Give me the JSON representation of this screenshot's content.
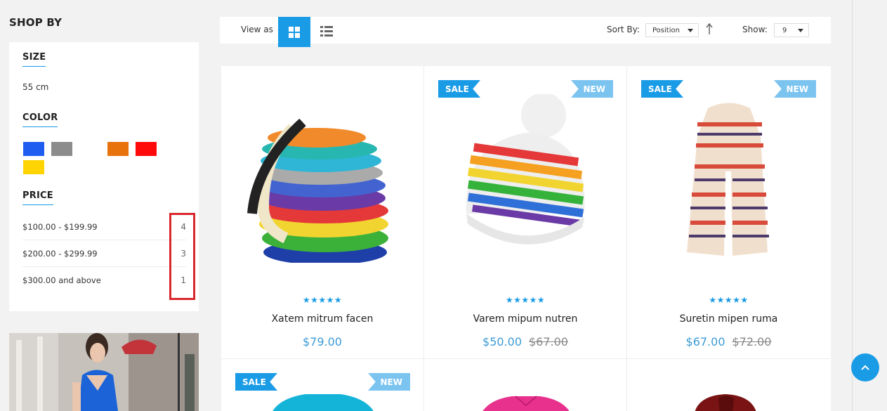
{
  "sidebar": {
    "title": "SHOP BY",
    "size": {
      "heading": "SIZE",
      "value": "55 cm"
    },
    "color": {
      "heading": "COLOR",
      "swatches": [
        "#1f5cf0",
        "#8c8c8c",
        "#ffffff",
        "#e8730c",
        "#ff0a0a",
        "#ffd400"
      ]
    },
    "price": {
      "heading": "PRICE",
      "ranges": [
        {
          "label": "$100.00 - $199.99",
          "count": "4"
        },
        {
          "label": "$200.00 - $299.99",
          "count": "3"
        },
        {
          "label": "$300.00 and above",
          "count": "1"
        }
      ]
    }
  },
  "toolbar": {
    "view_as": "View as",
    "sort_by": "Sort By:",
    "sort_value": "Position",
    "show": "Show:",
    "show_value": "9"
  },
  "products": [
    {
      "name": "Xatem mitrum facen",
      "price": "$79.00",
      "old_price": "",
      "sale": false,
      "new": false,
      "rating": "★★★★★"
    },
    {
      "name": "Varem mipum nutren",
      "price": "$50.00",
      "old_price": "$67.00",
      "sale": true,
      "new": true,
      "rating": "★★★★★"
    },
    {
      "name": "Suretin mipen ruma",
      "price": "$67.00",
      "old_price": "$72.00",
      "sale": true,
      "new": true,
      "rating": "★★★★★"
    }
  ],
  "badges": {
    "sale": "SALE",
    "new": "NEW"
  },
  "colors": {
    "accent": "#1a9be6",
    "highlight": "#d9272e"
  }
}
